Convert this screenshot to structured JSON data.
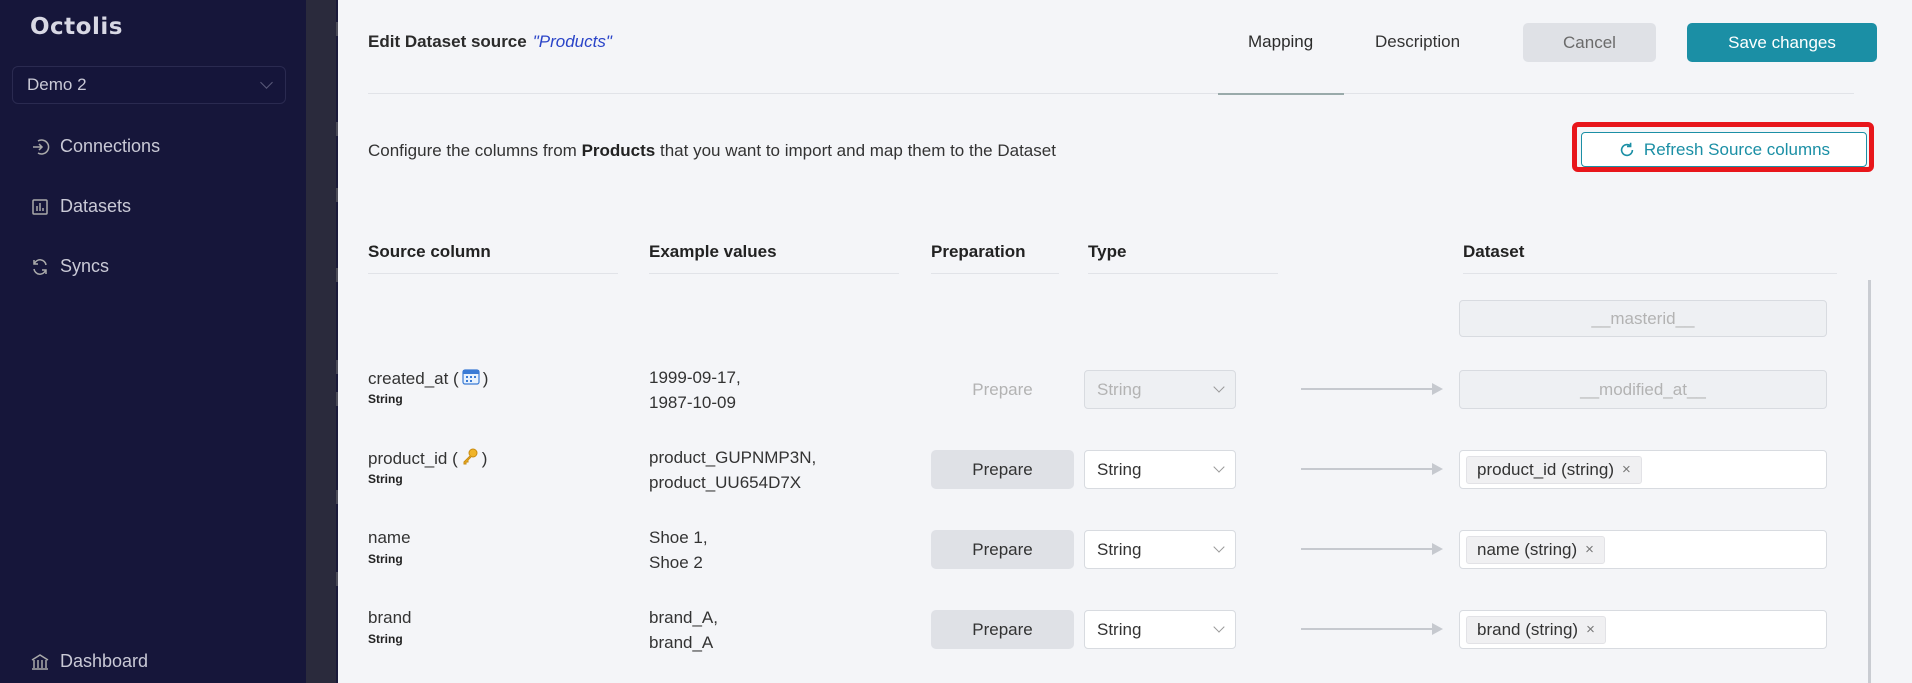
{
  "sidebar": {
    "logo": "Octolis",
    "workspace": "Demo 2",
    "items": [
      {
        "label": "Connections",
        "icon": "sign-in-icon"
      },
      {
        "label": "Datasets",
        "icon": "bar-chart-icon"
      },
      {
        "label": "Syncs",
        "icon": "sync-icon"
      },
      {
        "label": "Dashboard",
        "icon": "bank-icon"
      }
    ]
  },
  "modal": {
    "title": "Edit Dataset source",
    "dataset_name": "\"Products\"",
    "tabs": [
      "Mapping",
      "Description"
    ],
    "cancel_label": "Cancel",
    "save_label": "Save changes",
    "config_prefix": "Configure the columns from",
    "config_source": "Products",
    "config_suffix": "that you want to import and map them to the Dataset",
    "refresh_label": "Refresh Source columns",
    "columns": [
      "Source column",
      "Example values",
      "Preparation",
      "Type",
      "Dataset"
    ],
    "masterid": "__masterid__",
    "rows": [
      {
        "name": "created_at (",
        "icon": "calendar-icon",
        "name_close": ")",
        "type": "String",
        "ex1": "1999-09-17,",
        "ex2": "1987-10-09",
        "prep": "Prepare",
        "select": "String",
        "dest": "__modified_at__"
      },
      {
        "name": "product_id (",
        "icon": "key-icon",
        "name_close": ")",
        "type": "String",
        "ex1": "product_GUPNMP3N,",
        "ex2": "product_UU654D7X",
        "prep": "Prepare",
        "select": "String",
        "dest": "product_id (string)"
      },
      {
        "name": "name",
        "type": "String",
        "ex1": "Shoe 1,",
        "ex2": "Shoe 2",
        "prep": "Prepare",
        "select": "String",
        "dest": "name (string)"
      },
      {
        "name": "brand",
        "type": "String",
        "ex1": "brand_A,",
        "ex2": "brand_A",
        "prep": "Prepare",
        "select": "String",
        "dest": "brand (string)"
      }
    ]
  },
  "colors": {
    "accent": "#1b8fa5",
    "sidebar": "#16163a",
    "highlight": "#e8161b"
  }
}
